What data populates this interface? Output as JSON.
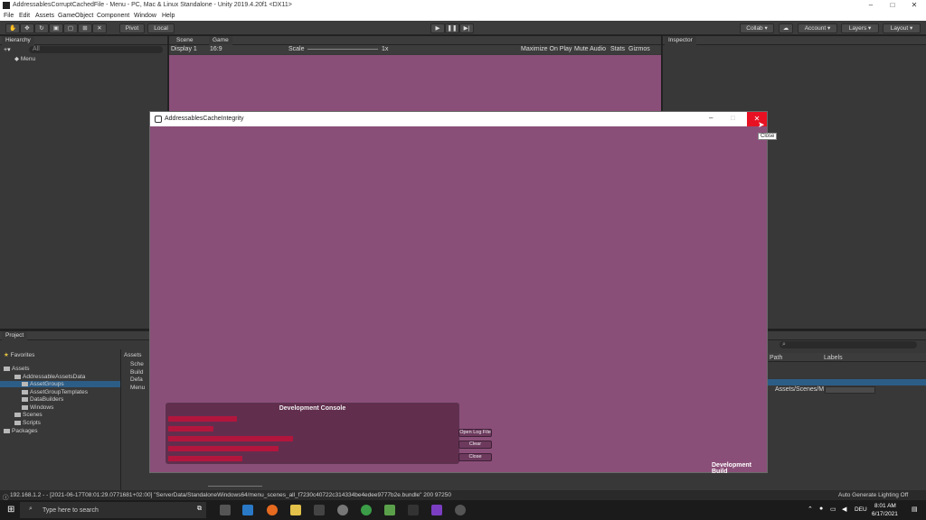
{
  "window": {
    "title": "AddressablesCorruptCachedFile - Menu - PC, Mac & Linux Standalone - Unity 2019.4.20f1 <DX11>",
    "minimize": "–",
    "maximize": "□",
    "close": "✕"
  },
  "menu": [
    "File",
    "Edit",
    "Assets",
    "GameObject",
    "Component",
    "Window",
    "Help"
  ],
  "toolbar": {
    "pivot": "Pivot",
    "local": "Local",
    "collab": "Collab ▾",
    "account": "Account ▾",
    "layers": "Layers ▾",
    "layout": "Layout ▾"
  },
  "hierarchy": {
    "tab": "Hierarchy",
    "search": "All",
    "root": "Menu"
  },
  "scene_tabs": {
    "scene": "Scene",
    "game": "Game"
  },
  "game_bar": {
    "display": "Display 1",
    "aspect": "16:9",
    "scale_label": "Scale",
    "scale_value": "1x",
    "maximize": "Maximize On Play",
    "mute": "Mute Audio",
    "stats": "Stats",
    "gizmos": "Gizmos"
  },
  "inspector": {
    "tab": "Inspector"
  },
  "game_window": {
    "title": "AddressablesCacheIntegrity",
    "tooltip": "Close",
    "build_label": "Development Build"
  },
  "dev_console": {
    "title": "Development Console",
    "buttons": {
      "open_log": "Open Log File",
      "clear": "Clear",
      "close": "Close"
    }
  },
  "project": {
    "tab": "Project",
    "favorites": "Favorites",
    "assets": "Assets",
    "tree": [
      "AddressableAssetsData",
      "AssetGroups",
      "AssetGroupTemplates",
      "DataBuilders",
      "Windows",
      "Scenes",
      "Scripts"
    ],
    "packages": "Packages",
    "breadcrumb": "Assets",
    "files": [
      "Sche",
      "Build",
      "Defa",
      "Menu"
    ],
    "columns": {
      "path": "Path",
      "labels": "Labels"
    },
    "row_path": "Assets/Scenes/M"
  },
  "status": {
    "log": "192.168.1.2 - - [2021-06-17T08:01:29.0771681+02:00] \"ServerData/StandaloneWindows64/menu_scenes_all_f7230c40722c314334be4edee9777b2e.bundle\" 200 97250",
    "right": "Auto Generate Lighting Off"
  },
  "taskbar": {
    "search": "Type here to search",
    "lang": "DEU",
    "time": "8:01 AM",
    "date": "6/17/2021"
  }
}
